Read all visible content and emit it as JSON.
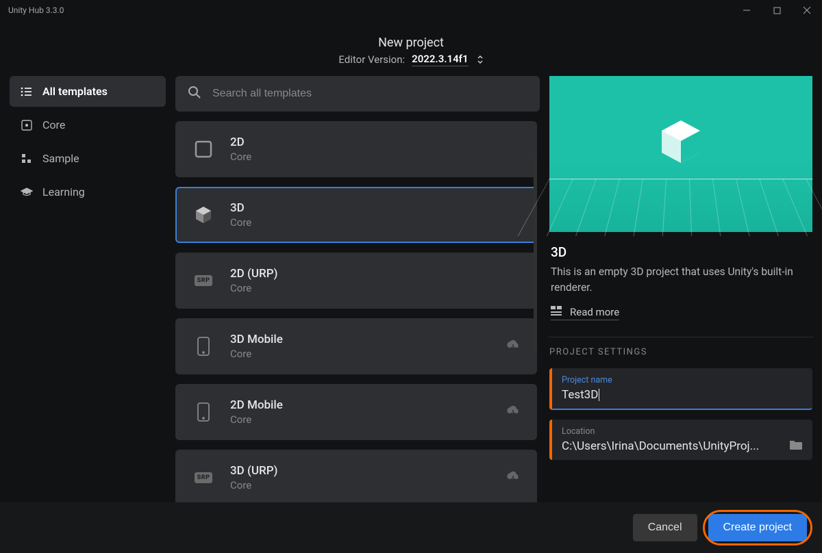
{
  "window": {
    "title": "Unity Hub 3.3.0"
  },
  "header": {
    "title": "New project",
    "editor_label": "Editor Version:",
    "editor_version": "2022.3.14f1"
  },
  "sidebar": {
    "items": [
      {
        "label": "All templates",
        "icon": "list-icon",
        "active": true
      },
      {
        "label": "Core",
        "icon": "square-dot-icon",
        "active": false
      },
      {
        "label": "Sample",
        "icon": "blocks-icon",
        "active": false
      },
      {
        "label": "Learning",
        "icon": "graduation-icon",
        "active": false
      }
    ]
  },
  "search": {
    "placeholder": "Search all templates"
  },
  "templates": [
    {
      "title": "2D",
      "subtitle": "Core",
      "icon": "square-outline",
      "selected": false,
      "download": false
    },
    {
      "title": "3D",
      "subtitle": "Core",
      "icon": "cube",
      "selected": true,
      "download": false
    },
    {
      "title": "2D (URP)",
      "subtitle": "Core",
      "icon": "srp",
      "selected": false,
      "download": false
    },
    {
      "title": "3D Mobile",
      "subtitle": "Core",
      "icon": "phone",
      "selected": false,
      "download": true
    },
    {
      "title": "2D Mobile",
      "subtitle": "Core",
      "icon": "phone",
      "selected": false,
      "download": true
    },
    {
      "title": "3D (URP)",
      "subtitle": "Core",
      "icon": "srp",
      "selected": false,
      "download": true
    }
  ],
  "details": {
    "title": "3D",
    "description": "This is an empty 3D project that uses Unity's built-in renderer.",
    "readmore": "Read more",
    "settings_header": "PROJECT SETTINGS",
    "project_name_label": "Project name",
    "project_name_value": "Test3D",
    "location_label": "Location",
    "location_value": "C:\\Users\\Irina\\Documents\\UnityProj..."
  },
  "footer": {
    "cancel": "Cancel",
    "create": "Create project"
  }
}
